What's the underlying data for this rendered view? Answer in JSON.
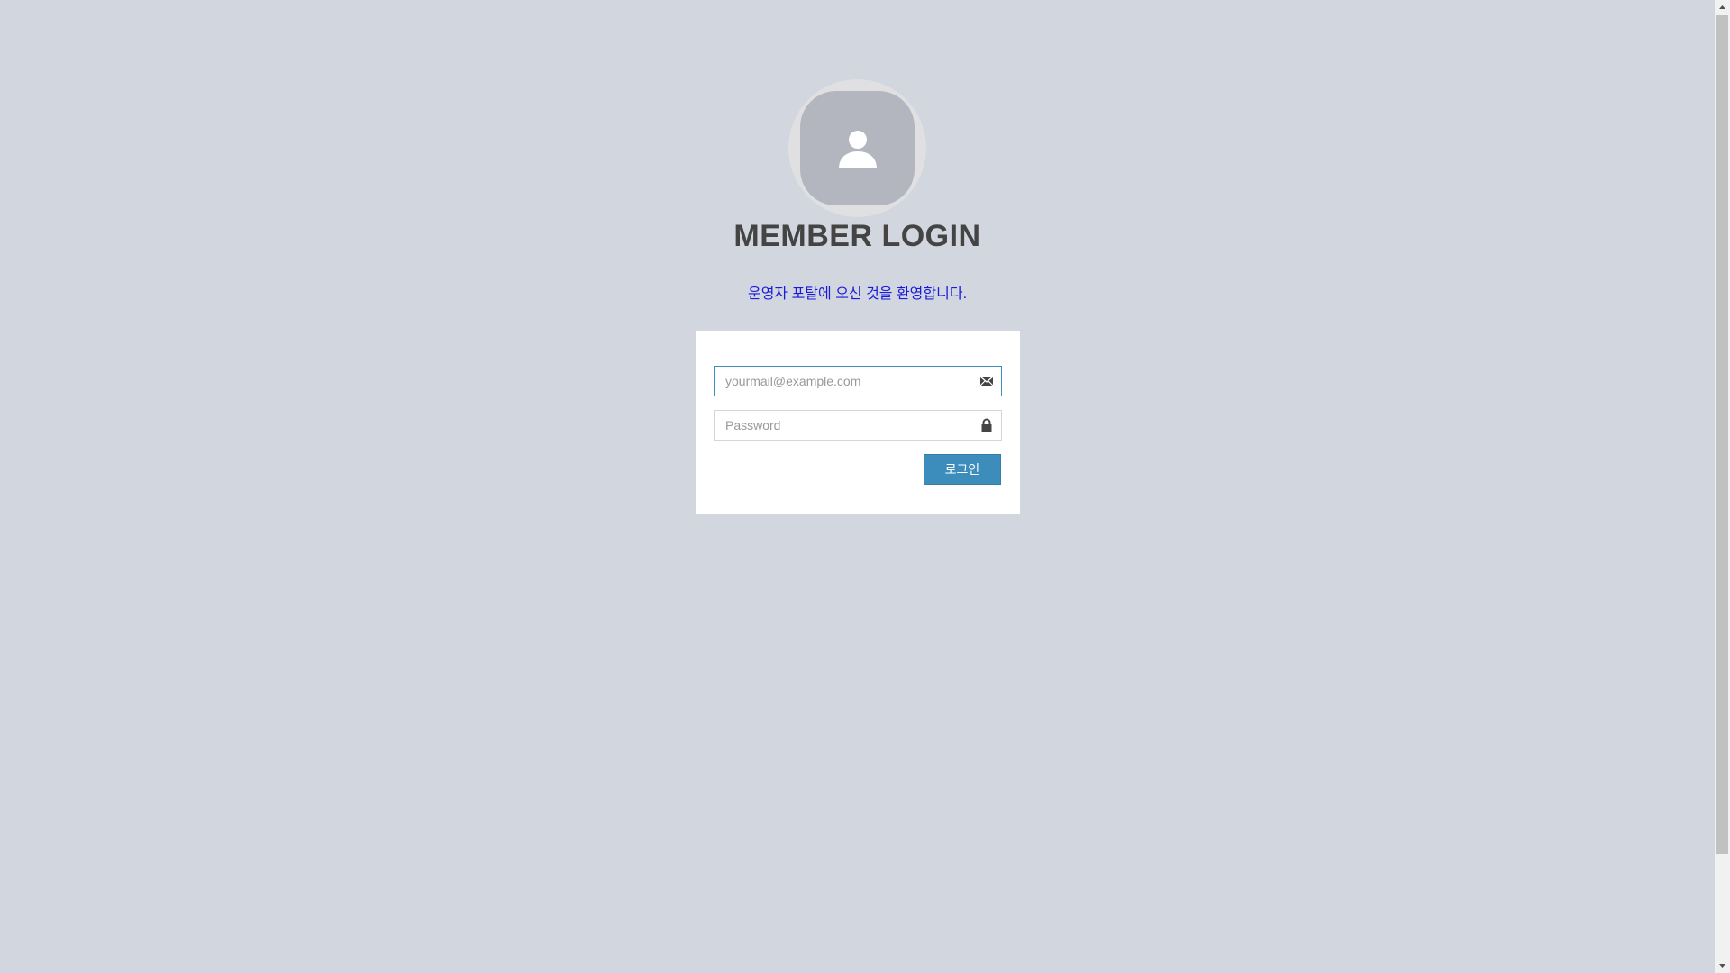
{
  "header": {
    "title": "MEMBER LOGIN",
    "subtitle": "운영자 포탈에 오신 것을 환영합니다."
  },
  "avatar": {
    "icon": "user-icon"
  },
  "form": {
    "email": {
      "placeholder": "yourmail@example.com",
      "value": "",
      "icon": "envelope-icon"
    },
    "password": {
      "placeholder": "Password",
      "value": "",
      "icon": "lock-icon"
    },
    "login_label": "로그인"
  },
  "colors": {
    "background": "#d2d6de",
    "primary": "#3c8dbc",
    "title": "#444444",
    "subtitle": "#1a1adc"
  }
}
